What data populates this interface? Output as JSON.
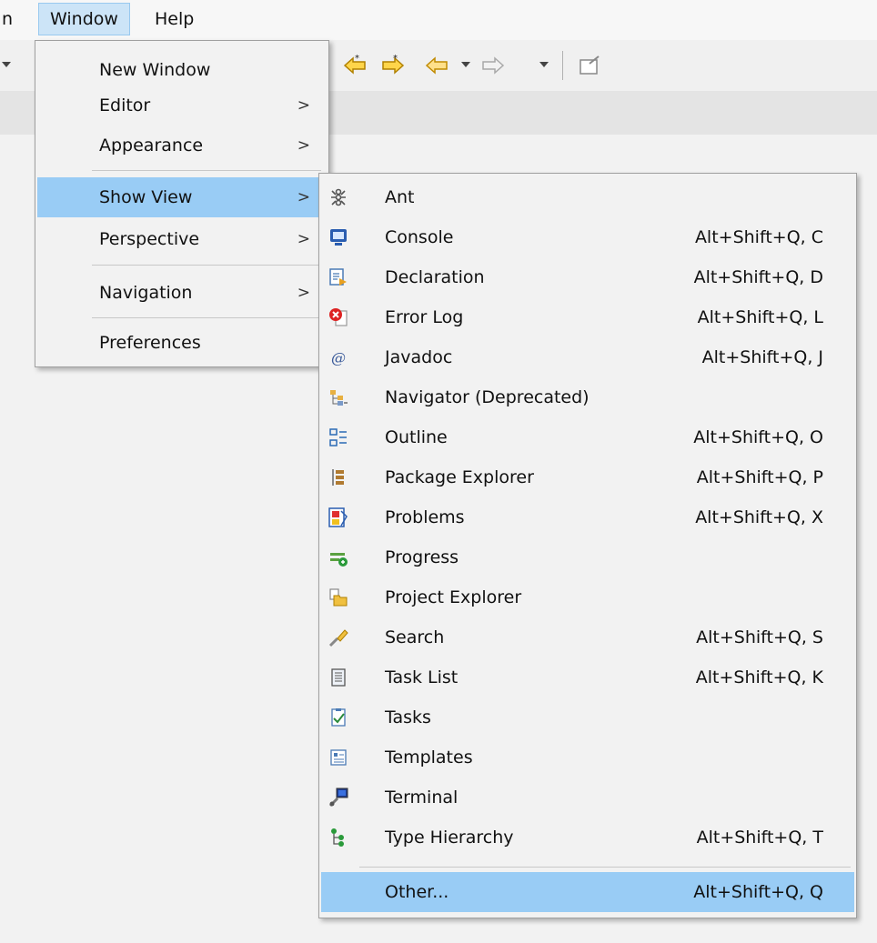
{
  "menubar": {
    "items": [
      {
        "label": "n"
      },
      {
        "label": "Window"
      },
      {
        "label": "Help"
      }
    ]
  },
  "window_menu": {
    "items": [
      {
        "label": "New Window",
        "arrow": ""
      },
      {
        "label": "Editor",
        "arrow": ">"
      },
      {
        "label": "Appearance",
        "arrow": ">"
      },
      {
        "label": "Show View",
        "arrow": ">"
      },
      {
        "label": "Perspective",
        "arrow": ">"
      },
      {
        "label": "Navigation",
        "arrow": ">"
      },
      {
        "label": "Preferences",
        "arrow": ""
      }
    ]
  },
  "show_view_menu": {
    "items": [
      {
        "label": "Ant",
        "shortcut": "",
        "icon": "ant-icon"
      },
      {
        "label": "Console",
        "shortcut": "Alt+Shift+Q, C",
        "icon": "console-icon"
      },
      {
        "label": "Declaration",
        "shortcut": "Alt+Shift+Q, D",
        "icon": "declaration-icon"
      },
      {
        "label": "Error Log",
        "shortcut": "Alt+Shift+Q, L",
        "icon": "error-log-icon"
      },
      {
        "label": "Javadoc",
        "shortcut": "Alt+Shift+Q, J",
        "icon": "javadoc-icon"
      },
      {
        "label": "Navigator (Deprecated)",
        "shortcut": "",
        "icon": "navigator-icon"
      },
      {
        "label": "Outline",
        "shortcut": "Alt+Shift+Q, O",
        "icon": "outline-icon"
      },
      {
        "label": "Package Explorer",
        "shortcut": "Alt+Shift+Q, P",
        "icon": "package-explorer-icon"
      },
      {
        "label": "Problems",
        "shortcut": "Alt+Shift+Q, X",
        "icon": "problems-icon"
      },
      {
        "label": "Progress",
        "shortcut": "",
        "icon": "progress-icon"
      },
      {
        "label": "Project Explorer",
        "shortcut": "",
        "icon": "project-explorer-icon"
      },
      {
        "label": "Search",
        "shortcut": "Alt+Shift+Q, S",
        "icon": "search-icon"
      },
      {
        "label": "Task List",
        "shortcut": "Alt+Shift+Q, K",
        "icon": "task-list-icon"
      },
      {
        "label": "Tasks",
        "shortcut": "",
        "icon": "tasks-icon"
      },
      {
        "label": "Templates",
        "shortcut": "",
        "icon": "templates-icon"
      },
      {
        "label": "Terminal",
        "shortcut": "",
        "icon": "terminal-icon"
      },
      {
        "label": "Type Hierarchy",
        "shortcut": "Alt+Shift+Q, T",
        "icon": "type-hierarchy-icon"
      },
      {
        "label": "Other...",
        "shortcut": "Alt+Shift+Q, Q",
        "icon": ""
      }
    ]
  },
  "colors": {
    "selection": "#99ccf5",
    "menubar_active": "#cce4f7",
    "menu_background": "#f2f2f2"
  }
}
